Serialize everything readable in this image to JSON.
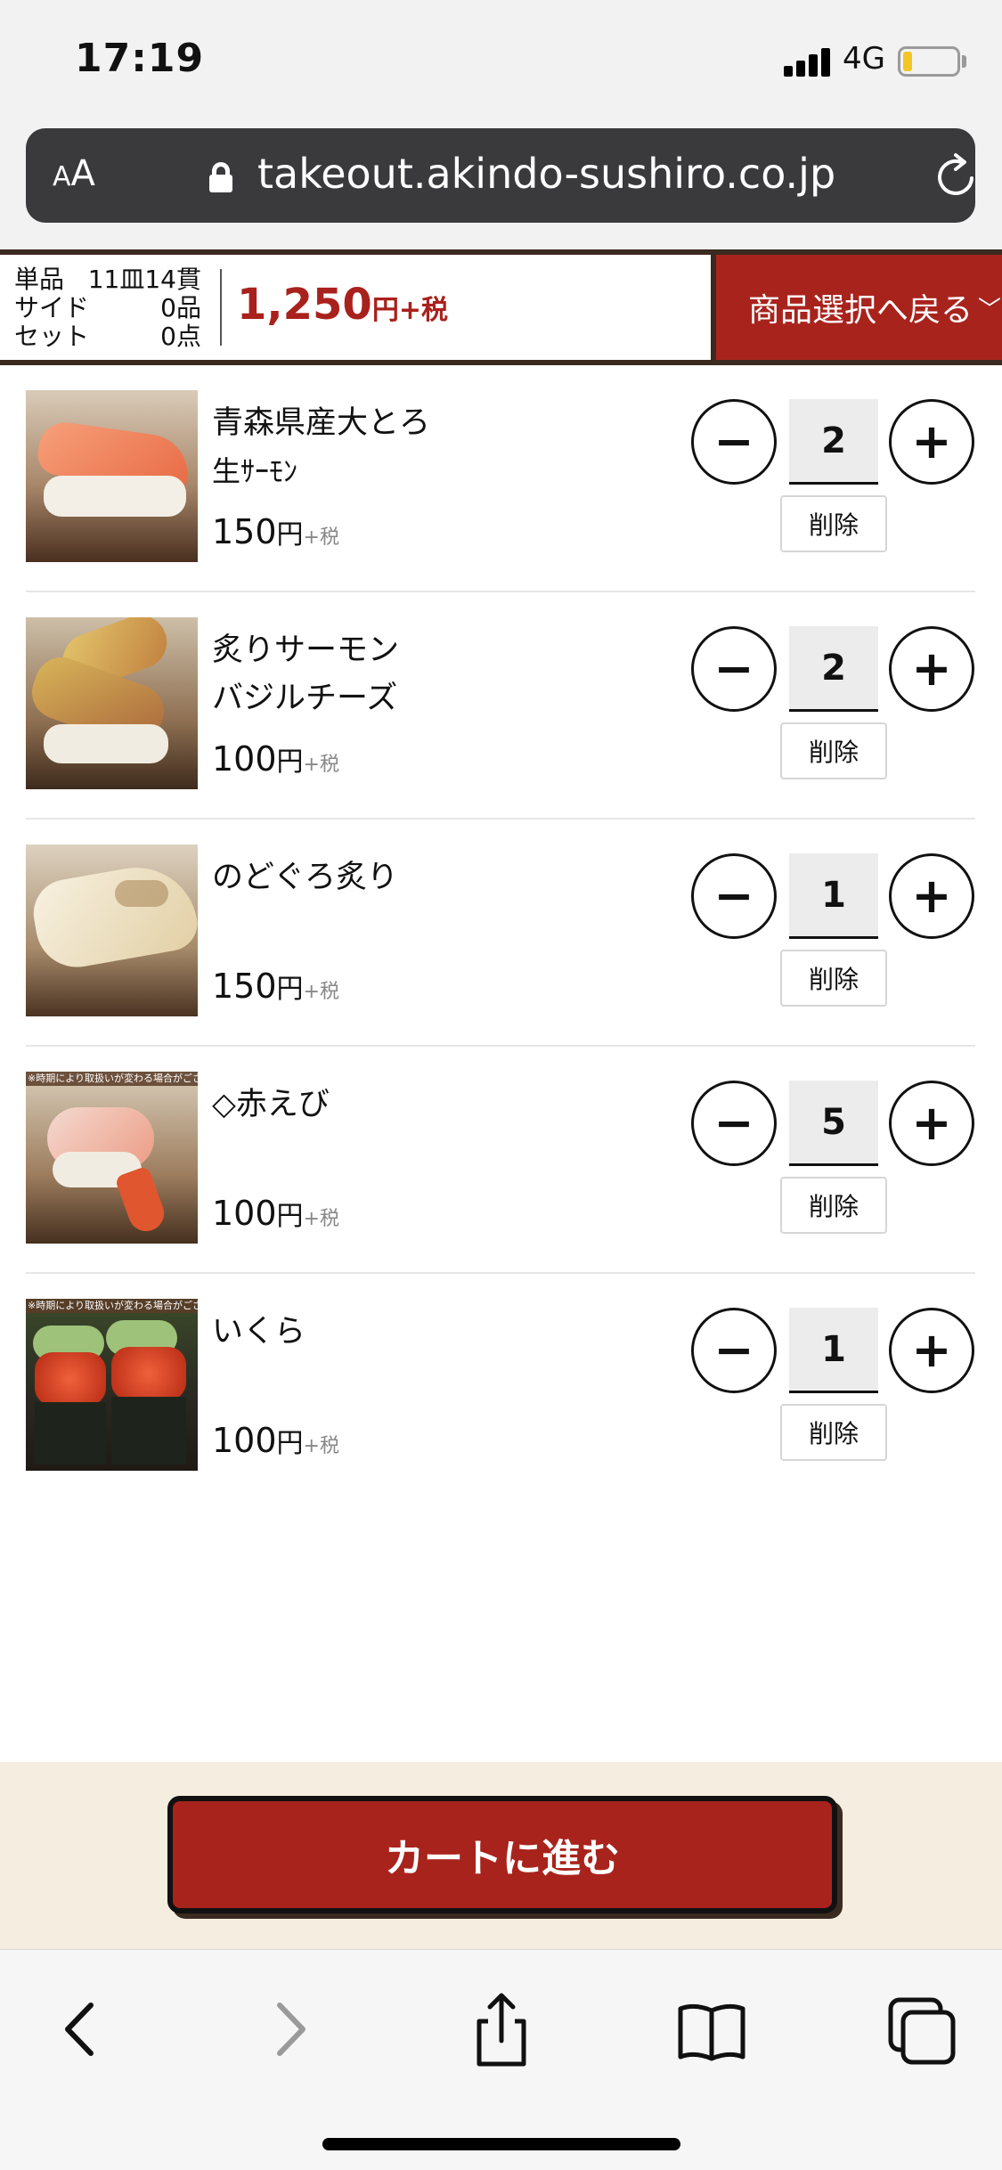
{
  "status_bar": {
    "time": "17:19",
    "network": "4G",
    "battery_level": 0.18
  },
  "browser": {
    "aa_label_small": "A",
    "aa_label_large": "A",
    "url": "takeout.akindo-sushiro.co.jp"
  },
  "summary": {
    "counts": [
      {
        "label": "単品",
        "value": "11皿14貫"
      },
      {
        "label": "サイド",
        "value": "0品"
      },
      {
        "label": "セット",
        "value": "0点"
      }
    ],
    "total_amount": "1,250",
    "total_unit": "円+税",
    "back_label": "商品選択へ戻る",
    "back_chevron": "﹀"
  },
  "items": [
    {
      "name": "青森県産大とろ",
      "sub": "生ｻｰﾓﾝ",
      "price": "150",
      "yen": "円",
      "tax": "+税",
      "qty": "2",
      "delete": "削除",
      "note": ""
    },
    {
      "name": "炙りサーモン",
      "sub": "バジルチーズ",
      "price": "100",
      "yen": "円",
      "tax": "+税",
      "qty": "2",
      "delete": "削除",
      "note": ""
    },
    {
      "name": "のどぐろ炙り",
      "sub": "",
      "price": "150",
      "yen": "円",
      "tax": "+税",
      "qty": "1",
      "delete": "削除",
      "note": ""
    },
    {
      "name": "◇赤えび",
      "sub": "",
      "price": "100",
      "yen": "円",
      "tax": "+税",
      "qty": "5",
      "delete": "削除",
      "note": "※時期により取扱いが変わる場合がございます"
    },
    {
      "name": "いくら",
      "sub": "",
      "price": "100",
      "yen": "円",
      "tax": "+税",
      "qty": "1",
      "delete": "削除",
      "note": "※時期により取扱いが変わる場合がございます"
    }
  ],
  "controls": {
    "minus": "−",
    "plus": "+"
  },
  "cart": {
    "label": "カートに進む"
  },
  "icons": {
    "lock": "lock-icon",
    "reload": "reload-icon",
    "back": "back-arrow-icon",
    "forward": "forward-arrow-icon",
    "share": "share-icon",
    "bookmarks": "bookmarks-icon",
    "tabs": "tabs-icon"
  },
  "colors": {
    "accent": "#a9231d",
    "border_dark": "#3b2a20",
    "footer_bg": "#f5ede0"
  }
}
